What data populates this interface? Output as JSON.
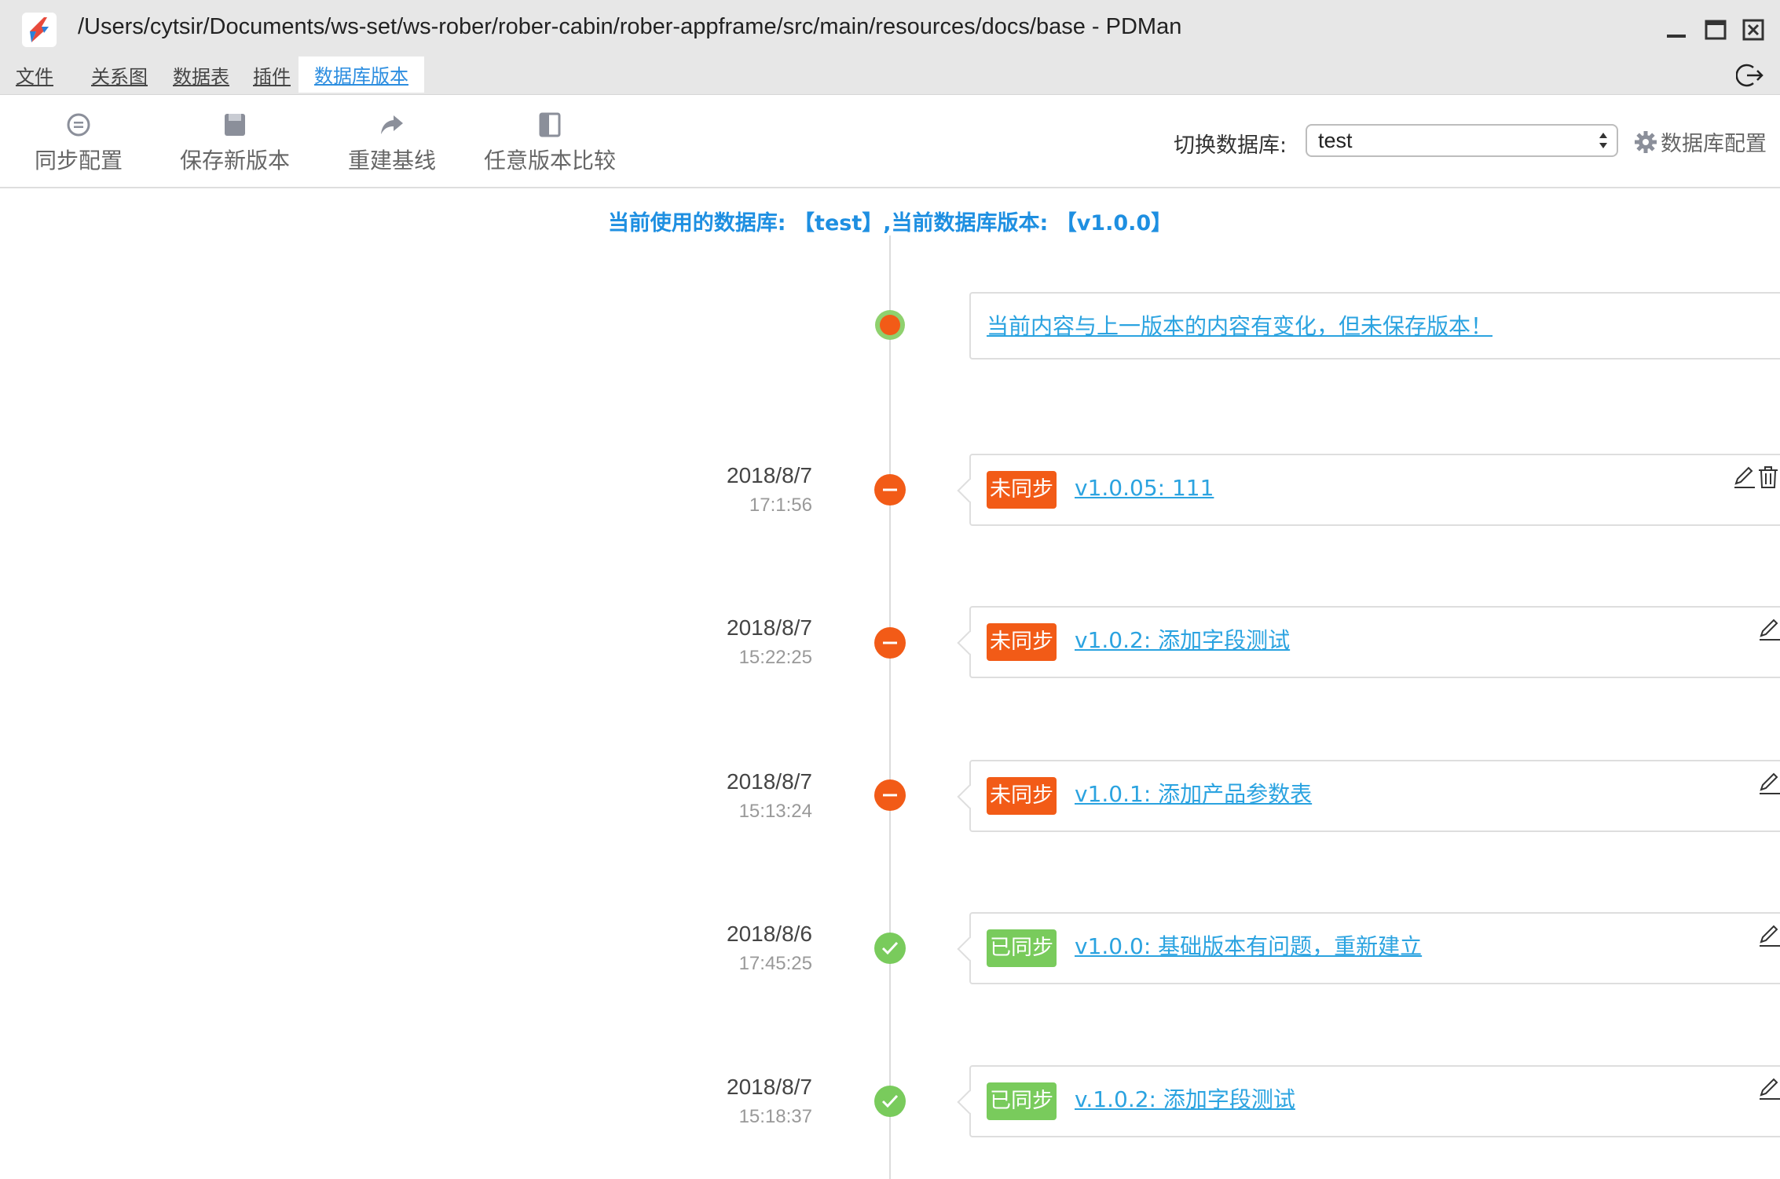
{
  "window": {
    "title": "/Users/cytsir/Documents/ws-set/ws-rober/rober-cabin/rober-appframe/src/main/resources/docs/base - PDMan"
  },
  "menu": {
    "items": [
      {
        "label": "文件"
      },
      {
        "label": "关系图"
      },
      {
        "label": "数据表"
      },
      {
        "label": "插件"
      },
      {
        "label": "数据库版本"
      }
    ],
    "active": "数据库版本"
  },
  "toolbar": {
    "sync_config": "同步配置",
    "save_new_version": "保存新版本",
    "rebuild_baseline": "重建基线",
    "compare_any_version": "任意版本比较",
    "switch_db_label": "切换数据库:",
    "selected_db": "test",
    "db_config": "数据库配置"
  },
  "status": {
    "prefix": "当前使用的数据库:",
    "db": "【test】",
    "middle": ",当前数据库版本:",
    "version": "【v1.0.0】"
  },
  "unsaved_message": "当前内容与上一版本的内容有变化，但未保存版本！",
  "entries": [
    {
      "date": "2018/8/7",
      "time": "17:1:56",
      "status": "未同步",
      "synced": false,
      "version": "v1.0.05: 111",
      "deletable": true
    },
    {
      "date": "2018/8/7",
      "time": "15:22:25",
      "status": "未同步",
      "synced": false,
      "version": "v1.0.2: 添加字段测试",
      "deletable": false
    },
    {
      "date": "2018/8/7",
      "time": "15:13:24",
      "status": "未同步",
      "synced": false,
      "version": "v1.0.1: 添加产品参数表",
      "deletable": false
    },
    {
      "date": "2018/8/6",
      "time": "17:45:25",
      "status": "已同步",
      "synced": true,
      "version": "v1.0.0: 基础版本有问题，重新建立",
      "deletable": false
    },
    {
      "date": "2018/8/7",
      "time": "15:18:37",
      "status": "已同步",
      "synced": true,
      "version": "v.1.0.2: 添加字段测试",
      "deletable": false
    }
  ],
  "colors": {
    "accent": "#1e8fe1",
    "link": "#2ba3e0",
    "unsynced": "#f25b17",
    "synced": "#79cb5c"
  }
}
